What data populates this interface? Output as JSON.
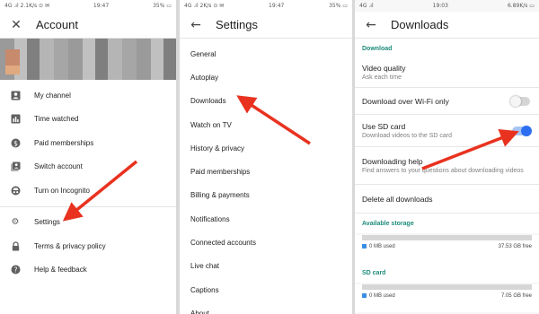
{
  "panel1": {
    "status": {
      "left": "4G .ıl 2.1K/s ⊙ ✉",
      "time": "19:47",
      "right": "35% ▭"
    },
    "title": "Account",
    "items": [
      {
        "label": "My channel",
        "icon": "person-icon"
      },
      {
        "label": "Time watched",
        "icon": "bar-chart-icon"
      },
      {
        "label": "Paid memberships",
        "icon": "dollar-icon"
      },
      {
        "label": "Switch account",
        "icon": "switch-account-icon"
      },
      {
        "label": "Turn on Incognito",
        "icon": "incognito-icon"
      },
      {
        "label": "Settings",
        "icon": "gear-icon"
      },
      {
        "label": "Terms & privacy policy",
        "icon": "lock-icon"
      },
      {
        "label": "Help & feedback",
        "icon": "help-icon"
      }
    ]
  },
  "panel2": {
    "status": {
      "left": "4G .ıl 2K/s ⊙ ✉",
      "time": "19:47",
      "right": "35% ▭"
    },
    "title": "Settings",
    "items": [
      "General",
      "Autoplay",
      "Downloads",
      "Watch on TV",
      "History & privacy",
      "Paid memberships",
      "Billing & payments",
      "Notifications",
      "Connected accounts",
      "Live chat",
      "Captions",
      "About"
    ]
  },
  "panel3": {
    "status": {
      "left": "4G .ıl",
      "time": "19:03",
      "right": "6.89K/s ▭"
    },
    "title": "Downloads",
    "section_download": "Download",
    "video_quality": {
      "title": "Video quality",
      "sub": "Ask each time"
    },
    "wifi_only": {
      "title": "Download over Wi-Fi only",
      "on": false
    },
    "sd_card": {
      "title": "Use SD card",
      "sub": "Download videos to the SD card",
      "on": true
    },
    "help": {
      "title": "Downloading help",
      "sub": "Find answers to your questions about downloading videos"
    },
    "delete_all": "Delete all downloads",
    "available_storage": {
      "title": "Available storage",
      "used": "0 MB used",
      "free": "37.53 GB free",
      "used_fraction": 0.0
    },
    "sd_storage": {
      "title": "SD card",
      "used": "0 MB used",
      "free": "7.05 GB free",
      "used_fraction": 0.0
    }
  },
  "colors": {
    "accent": "#1e8b7a",
    "toggle_on": "#2d6ff0",
    "arrow": "#e8321f"
  }
}
